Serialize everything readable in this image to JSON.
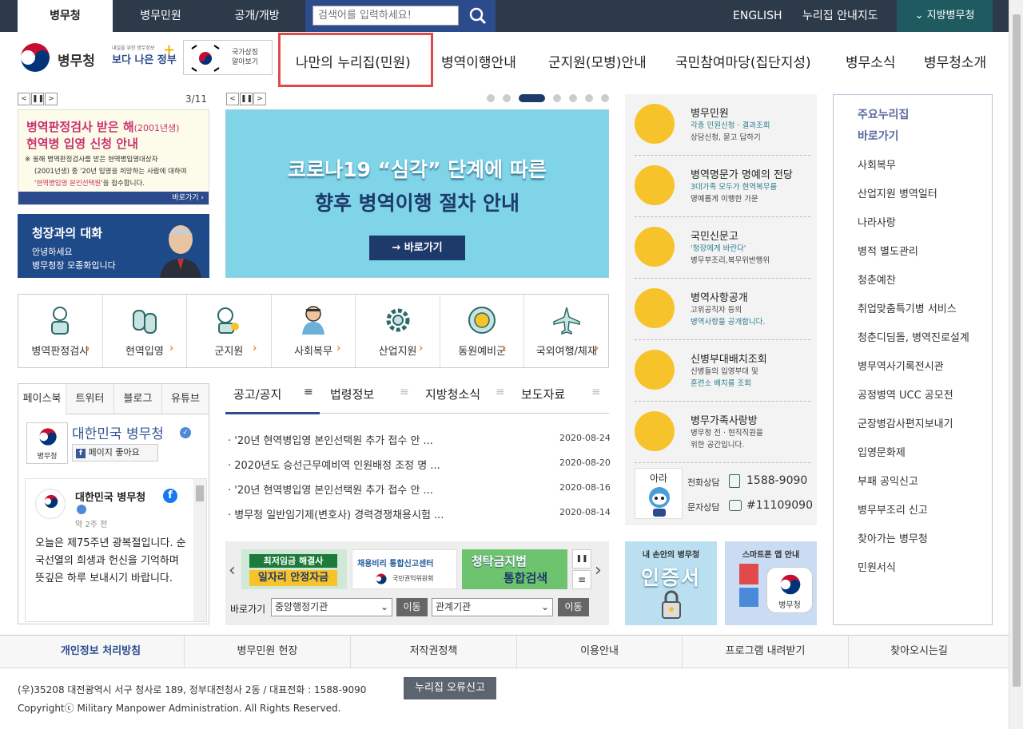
{
  "topbar": {
    "tabs": [
      "병무청",
      "병무민원",
      "공개/개방"
    ],
    "search_placeholder": "검색어를 입력하세요!",
    "links": [
      "ENGLISH",
      "누리집 안내지도"
    ],
    "regional": "지방병무청"
  },
  "header": {
    "logo_text": "병무청",
    "slogan_small": "내일을 위한 병무정보",
    "slogan_big": "보다 나은 정부",
    "national_symbol": "국가상징\n알아보기",
    "gnb": [
      "나만의 누리집(민원)",
      "병역이행안내",
      "군지원(모병)안내",
      "국민참여마당(집단지성)",
      "병무소식",
      "병무청소개"
    ]
  },
  "left_slider": {
    "counter": "3/11",
    "banner1": {
      "line1a": "병역판정검사 받은 해",
      "line1b": "(2001년생)",
      "line2": "현역병 입영 신청 안내",
      "desc1": "※ 올해 병역판정검사를 받은 현역병입영대상자",
      "desc2": "(2001년생) 중 '20년 입영을 희망하는 사람에 대하여",
      "desc3a": "'현역병입영 본인선택원",
      "desc3b": "'을 접수합니다.",
      "go": "바로가기 ›"
    },
    "banner2": {
      "title": "청장과의 대화",
      "line1": "안녕하세요",
      "line2": "병무청장 모종화입니다"
    }
  },
  "main_banner": {
    "line1": "코로나19 “심각” 단계에 따른",
    "line2": "향후 병역이행 절차 안내",
    "button": "→ 바로가기"
  },
  "quickmenu": [
    "병역판정검사",
    "현역입영",
    "군지원",
    "사회복무",
    "산업지원",
    "동원예비군",
    "국외여행/체재"
  ],
  "sns": {
    "tabs": [
      "페이스북",
      "트위터",
      "블로그",
      "유튜브"
    ],
    "page_name": "대한민국 병무청",
    "like": "페이지 좋아요",
    "post_author": "대한민국 병무청",
    "post_time": "약 2주 전",
    "post_text": "오늘은 제75주년 광복절입니다. 순국선열의 희생과 헌신을 기억하며 뜻깊은 하루 보내시기 바랍니다.",
    "logo_label": "병무청"
  },
  "notice": {
    "tabs": [
      "공고/공지",
      "법령정보",
      "지방청소식",
      "보도자료"
    ],
    "items": [
      {
        "title": "'20년 현역병입영 본인선택원 추가 접수 안 ...",
        "date": "2020-08-24"
      },
      {
        "title": "2020년도 승선근무예비역 인원배정 조정 명 ...",
        "date": "2020-08-20"
      },
      {
        "title": "'20년 현역병입영 본인선택원 추가 접수 안 ...",
        "date": "2020-08-16"
      },
      {
        "title": "병무청 일반임기제(변호사) 경력경쟁채용시험 ...",
        "date": "2020-08-14"
      }
    ]
  },
  "banners_bottom": {
    "b1a": "최저임금 해결사",
    "b1b": "일자리 안정자금",
    "b2a": "채용비리 통합신고센터",
    "b2b": "국민권익위원회",
    "b3a": "청탁금지법",
    "b3b": "통합검색",
    "goto_label": "바로가기",
    "select1": "중앙행정기관",
    "select2": "관계기관",
    "move": "이동"
  },
  "services": [
    {
      "title": "병무민원",
      "desc": [
        "각종 민원신청 · 결과조회",
        "상담신청, 묻고 답하기"
      ]
    },
    {
      "title": "병역명문가 명예의 전당",
      "desc": [
        "3대가족 모두가 현역복무를",
        "명예롭게 이행한 가문"
      ]
    },
    {
      "title": "국민신문고",
      "desc": [
        "'청장에게 바란다'",
        "병무부조리,복무위반행위"
      ]
    },
    {
      "title": "병역사항공개",
      "desc": [
        "고위공직자 등의",
        "병역사항을 공개합니다."
      ]
    },
    {
      "title": "신병부대배치조회",
      "desc": [
        "신병들의 입영부대 및",
        "훈련소 배치를 조회"
      ]
    },
    {
      "title": "병무가족사랑방",
      "desc": [
        "병무청 전 · 현직직원을",
        "위한 공간입니다."
      ]
    }
  ],
  "contact": {
    "ara": "아라",
    "phone_label": "전화상담",
    "phone": "1588-9090",
    "text_label": "문자상담",
    "text": "#11109090"
  },
  "apps": {
    "cert_title": "내 손안의 병무청",
    "cert_big": "인증서",
    "app_title": "스마트폰 앱 안내",
    "app_label": "병무청"
  },
  "quicklinks": {
    "title1": "주요누리집",
    "title2": "바로가기",
    "items": [
      "사회복무",
      "산업지원 병역일터",
      "나라사랑",
      "병적 별도관리",
      "청춘예찬",
      "취업맞춤특기병 서비스",
      "청춘디딤돌, 병역진로설계",
      "병무역사기록전시관",
      "공정병역 UCC 공모전",
      "군장병감사편지보내기",
      "입영문화제",
      "부패 공익신고",
      "병무부조리 신고",
      "찾아가는 병무청",
      "민원서식"
    ]
  },
  "footer": {
    "nav": [
      "개인정보 처리방침",
      "병무민원 헌장",
      "저작권정책",
      "이용안내",
      "프로그램 내려받기",
      "찾아오시는길"
    ],
    "address": "(우)35208 대전광역시 서구 청사로 189, 정부대전청사 2동 / 대표전화 : 1588-9090",
    "report": "누리집 오류신고",
    "copyright": "Copyrightⓒ Military Manpower Administration. All Rights Reserved."
  },
  "colors": {
    "topbar": "#2d3a4a",
    "search_bg": "#2b4b8c",
    "regional": "#1e5a5f",
    "highlight": "#e04a4a",
    "service_circle": "#f7c32b",
    "banner_blue": "#1e3a6a"
  }
}
